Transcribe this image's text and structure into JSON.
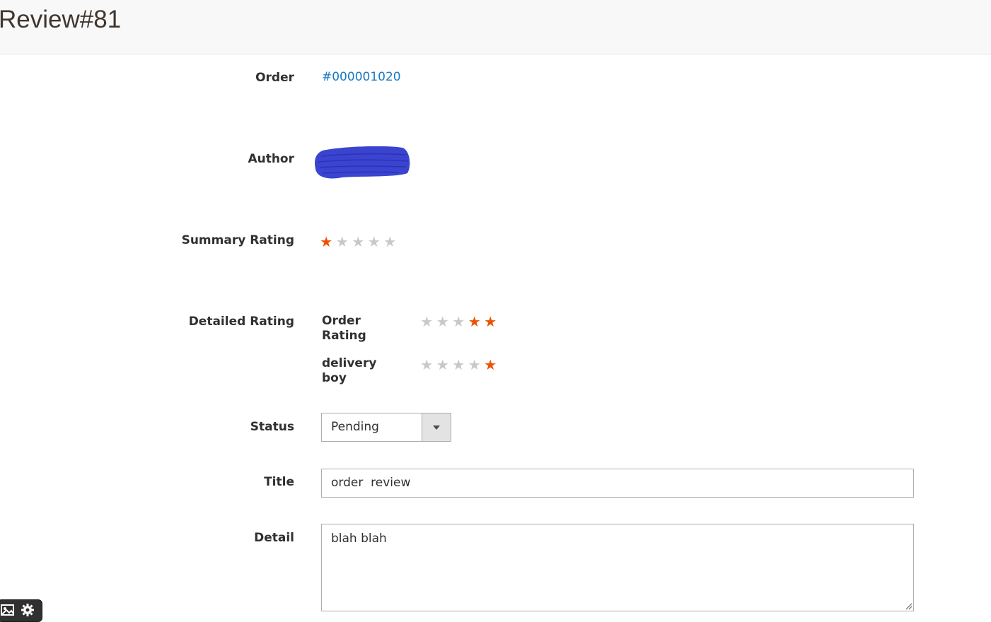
{
  "page": {
    "title": "Review#81"
  },
  "fields": {
    "order": {
      "label": "Order",
      "link_text": "#000001020"
    },
    "author": {
      "label": "Author"
    },
    "summary_rating": {
      "label": "Summary Rating",
      "value": 1,
      "max": 5
    },
    "detailed_rating": {
      "label": "Detailed Rating",
      "items": [
        {
          "label_line1": "Order",
          "label_line2": "Rating",
          "value": 2,
          "max": 5
        },
        {
          "label_line1": "delivery",
          "label_line2": "boy",
          "value": 1,
          "max": 5
        }
      ]
    },
    "status": {
      "label": "Status",
      "selected": "Pending"
    },
    "title": {
      "label": "Title",
      "value": "order  review"
    },
    "detail": {
      "label": "Detail",
      "value": "blah blah"
    }
  },
  "colors": {
    "accent_link": "#1979c3",
    "star_on": "#eb5202",
    "star_off": "#c8c8c8",
    "redaction": "#3a44cf"
  },
  "icons": {
    "select_arrow": "chevron-down-icon",
    "toolbar": [
      "image-icon",
      "gear-icon"
    ]
  }
}
